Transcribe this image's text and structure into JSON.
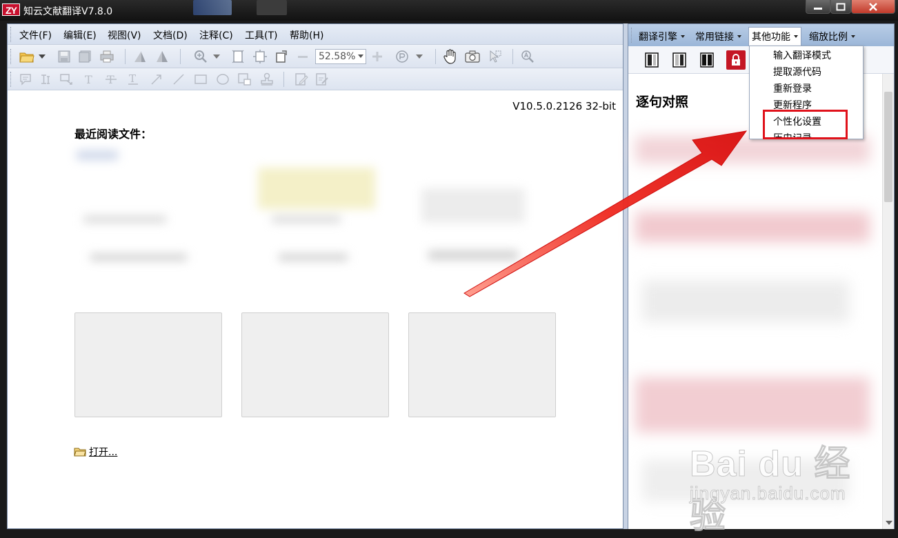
{
  "window": {
    "title": "知云文献翻译V7.8.0",
    "logo_text": "ZY"
  },
  "menubar": {
    "items": [
      {
        "label": "文件(F)"
      },
      {
        "label": "编辑(E)"
      },
      {
        "label": "视图(V)"
      },
      {
        "label": "文档(D)"
      },
      {
        "label": "注释(C)"
      },
      {
        "label": "工具(T)"
      },
      {
        "label": "帮助(H)"
      }
    ]
  },
  "toolbar": {
    "zoom_value": "52.58%"
  },
  "viewer": {
    "version": "V10.5.0.2126 32-bit",
    "recent_title": "最近阅读文件：",
    "open_label": "打开..."
  },
  "right_pane": {
    "menus": [
      {
        "label": "翻译引擎"
      },
      {
        "label": "常用链接"
      },
      {
        "label": "其他功能"
      },
      {
        "label": "缩放比例"
      }
    ],
    "dropdown": [
      {
        "label": "输入翻译模式"
      },
      {
        "label": "提取源代码"
      },
      {
        "label": "重新登录"
      },
      {
        "label": "更新程序"
      },
      {
        "label": "个性化设置"
      },
      {
        "label": "历史记录"
      }
    ],
    "section_title": "逐句对照"
  },
  "watermark": {
    "main": "Bai du 经验",
    "sub": "jingyan.baidu.com"
  },
  "colors": {
    "accent_red": "#e0121b",
    "menubar_blue": "#b9cde6"
  }
}
